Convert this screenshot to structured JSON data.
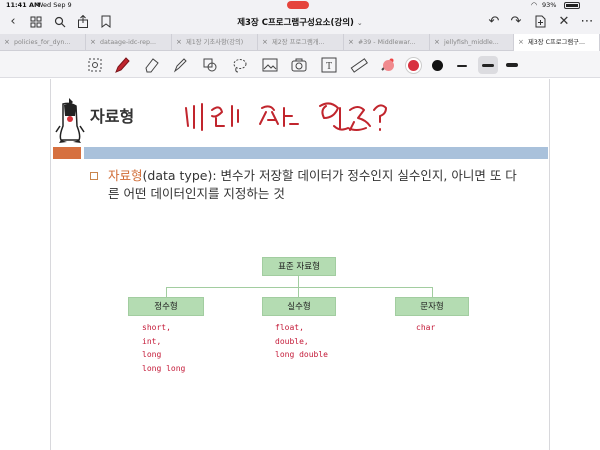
{
  "status_bar": {
    "time": "11:41 AM",
    "date": "Wed Sep 9",
    "battery": "93%"
  },
  "title_bar": {
    "title": "제3장 C프로그램구성요소(강의)"
  },
  "tabs": [
    {
      "label": "policies_for_dyn..."
    },
    {
      "label": "dataage-idc-rep..."
    },
    {
      "label": "제1장 기초사항(강의)"
    },
    {
      "label": "제2장 프로그램개..."
    },
    {
      "label": "#39 - Middlewar..."
    },
    {
      "label": "jellyfish_middle..."
    },
    {
      "label": "제3장 C프로그램구..."
    }
  ],
  "tools": {
    "colors": [
      "#f08a8e",
      "#d8313f",
      "#111111"
    ]
  },
  "slide": {
    "heading": "자료형",
    "paragraph_term": "자료형",
    "paragraph_rest": "(data type): 변수가 저장할 데이터가 정수인지 실수인지, 아니면 또 다른 어떤 데이터인지를 지정하는 것",
    "diagram": {
      "root": "표준 자료형",
      "children": [
        {
          "label": "정수형",
          "items": [
            "short,",
            "int,",
            "long",
            "long long"
          ]
        },
        {
          "label": "실수형",
          "items": [
            "float,",
            "double,",
            "long double"
          ]
        },
        {
          "label": "문자형",
          "items": [
            "char"
          ]
        }
      ]
    }
  }
}
